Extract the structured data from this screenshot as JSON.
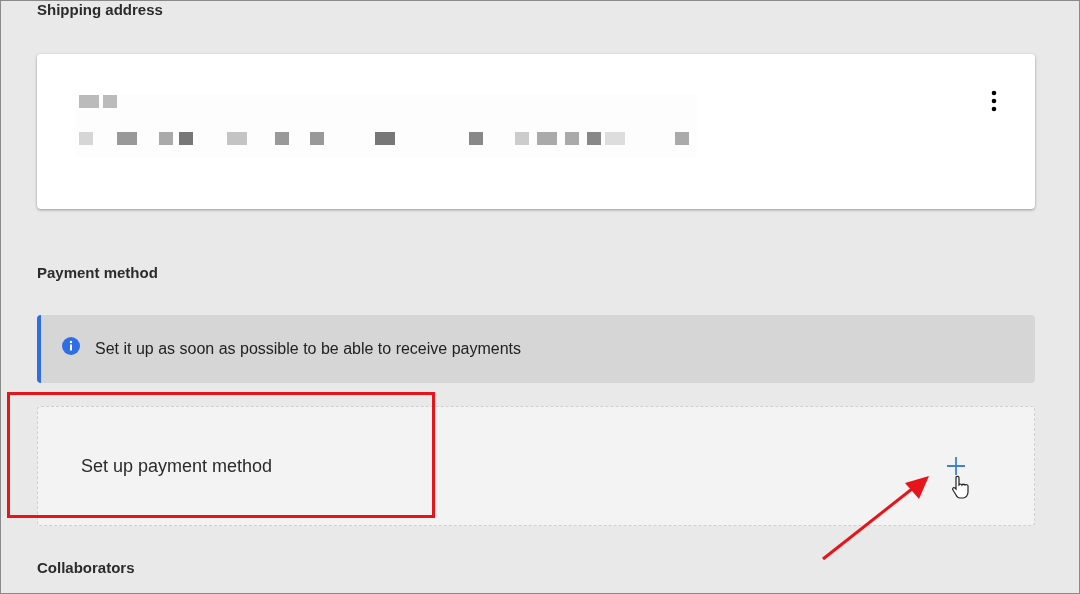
{
  "shipping_address": {
    "heading": "Shipping address",
    "card": {
      "kind": "address"
    }
  },
  "payment_method": {
    "heading": "Payment method",
    "info_banner": {
      "text": "Set it up as soon as possible to be able to receive payments"
    },
    "setup_card": {
      "label": "Set up payment method"
    }
  },
  "collaborators": {
    "heading": "Collaborators"
  }
}
